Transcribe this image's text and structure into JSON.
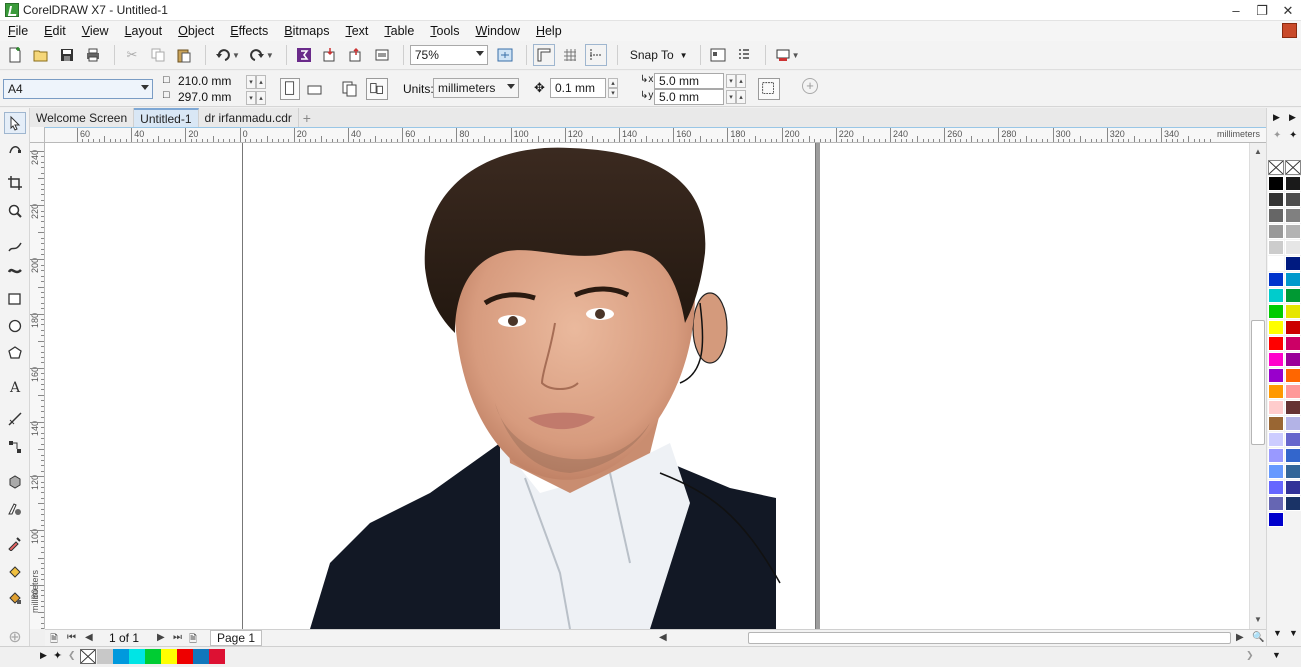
{
  "window": {
    "title": "CorelDRAW X7 - Untitled-1"
  },
  "menu": [
    {
      "label": "File",
      "acc": "F",
      "rest": "ile"
    },
    {
      "label": "Edit",
      "acc": "E",
      "rest": "dit"
    },
    {
      "label": "View",
      "acc": "V",
      "rest": "iew"
    },
    {
      "label": "Layout",
      "acc": "L",
      "rest": "ayout"
    },
    {
      "label": "Object",
      "acc": "O",
      "rest": "bject"
    },
    {
      "label": "Effects",
      "acc": "E",
      "rest": "ffects"
    },
    {
      "label": "Bitmaps",
      "acc": "B",
      "rest": "itmaps"
    },
    {
      "label": "Text",
      "acc": "T",
      "rest": "ext"
    },
    {
      "label": "Table",
      "acc": "T",
      "rest": "able"
    },
    {
      "label": "Tools",
      "acc": "T",
      "rest": "ools"
    },
    {
      "label": "Window",
      "acc": "W",
      "rest": "indow"
    },
    {
      "label": "Help",
      "acc": "H",
      "rest": "elp"
    }
  ],
  "toolbar": {
    "zoom_value": "75%",
    "snap_label": "Snap To"
  },
  "propbar": {
    "page_size": "A4",
    "width": "210.0 mm",
    "height": "297.0 mm",
    "units_label": "Units:",
    "units_value": "millimeters",
    "nudge": "0.1 mm",
    "dup_x": "5.0 mm",
    "dup_y": "5.0 mm"
  },
  "tabs": [
    {
      "label": "Welcome Screen",
      "active": false
    },
    {
      "label": "Untitled-1",
      "active": true
    },
    {
      "label": "dr irfanmadu.cdr",
      "active": false
    }
  ],
  "hruler": {
    "labels": [
      "60",
      "40",
      "20",
      "0",
      "20",
      "40",
      "60",
      "80",
      "100",
      "120",
      "140",
      "160",
      "180",
      "200",
      "220",
      "240",
      "260",
      "280",
      "300",
      "320",
      "340"
    ],
    "unit": "millimeters"
  },
  "vruler": {
    "labels": [
      "240",
      "220",
      "200",
      "180",
      "160",
      "140",
      "120",
      "100",
      "80"
    ],
    "unit": "millimeters"
  },
  "pagenav": {
    "count": "1 of 1",
    "page_tab": "Page 1"
  },
  "colors": {
    "accent": "#7ea7d4",
    "palette": [
      "#000000",
      "#1a1a1a",
      "#333333",
      "#4d4d4d",
      "#666666",
      "#808080",
      "#999999",
      "#b3b3b3",
      "#cccccc",
      "#e6e6e6",
      "#ffffff",
      "#001a80",
      "#0033cc",
      "#0099cc",
      "#00cccc",
      "#009933",
      "#00cc00",
      "#e6e600",
      "#ffff00",
      "#cc0000",
      "#ff0000",
      "#cc0066",
      "#ff00cc",
      "#990099",
      "#9900cc",
      "#ff6600",
      "#ff9900",
      "#ff9999",
      "#ffcccc",
      "#663333",
      "#996633",
      "#b3b3e6",
      "#ccccff",
      "#6666cc",
      "#9999ff",
      "#3366cc",
      "#6699ff",
      "#336699",
      "#6666ff",
      "#333399",
      "#6666b3",
      "#1a3366",
      "#0000cc"
    ],
    "doc_palette": [
      "#c8c8c8",
      "#0099dd",
      "#00e5e5",
      "#00cc33",
      "#ffff00",
      "#ee0000",
      "#1177bb",
      "#dd1133"
    ]
  }
}
